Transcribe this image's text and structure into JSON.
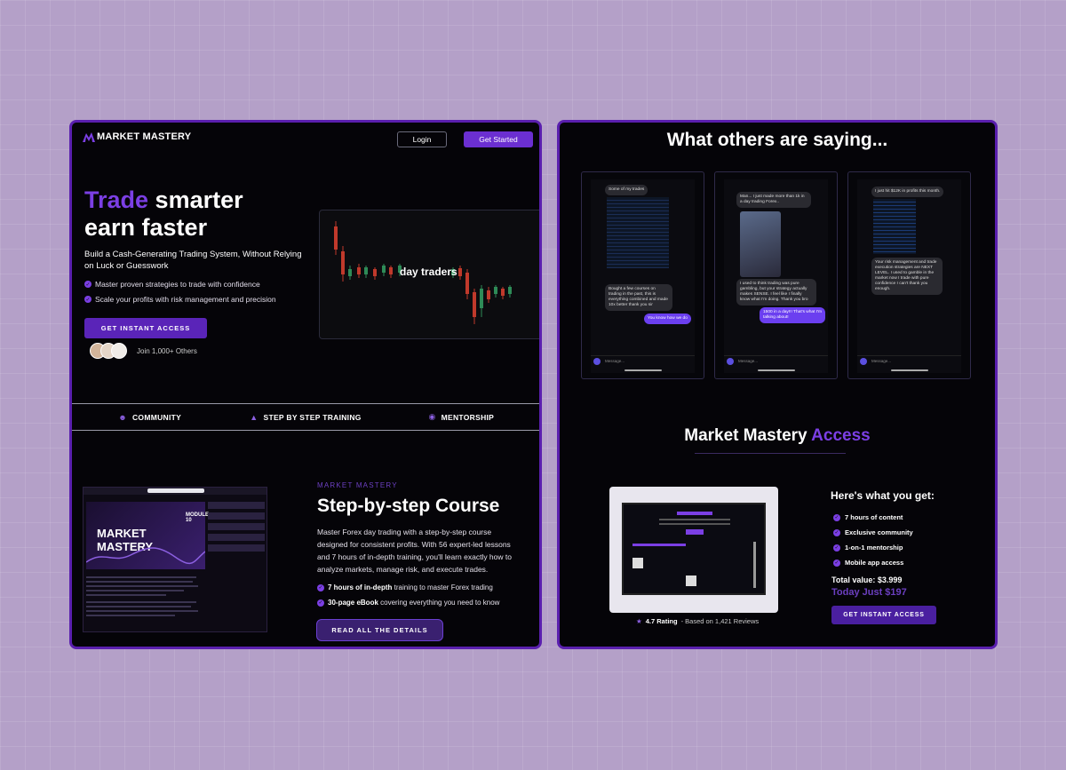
{
  "header": {
    "logo": "MARKET MASTERY",
    "login_label": "Login",
    "get_started_label": "Get Started"
  },
  "hero": {
    "title_accent": "Trade",
    "title_rest": " smarter",
    "title_line2": "earn faster",
    "subtitle": "Build a Cash-Generating Trading System, Without Relying on Luck or Guesswork",
    "bullets": [
      "Master proven strategies to trade with confidence",
      "Scale your profits with risk management and precision"
    ],
    "cta_label": "GET INSTANT ACCESS",
    "social_proof": "Join 1,000+ Others",
    "video_caption": "day traders"
  },
  "features": [
    {
      "icon": "users-icon",
      "label": "COMMUNITY"
    },
    {
      "icon": "graduation-cap-icon",
      "label": "STEP BY STEP TRAINING"
    },
    {
      "icon": "medal-icon",
      "label": "MENTORSHIP"
    }
  ],
  "course": {
    "kicker": "MARKET MASTERY",
    "title": "Step-by-step Course",
    "body": "Master Forex day trading with a step-by-step course designed for consistent profits. With 56 expert-led lessons and 7 hours of in-depth training, you'll learn exactly how to analyze markets, manage risk, and execute trades.",
    "bullet1_bold": "7 hours of in-depth",
    "bullet1_rest": " training to master Forex trading",
    "bullet2_bold": "30-page eBook",
    "bullet2_rest": " covering everything you need to know",
    "cta_label": "READ ALL THE DETAILS",
    "module_tag": "MODULE 10",
    "screenshot_logo": "MARKET MASTERY"
  },
  "testimonials": {
    "title": "What others are saying...",
    "phones": [
      {
        "top_msg": "Some of my trades",
        "msg2": "Bought a few courses on trading in the past, this is everything combined and made 10x better thank you sir",
        "reply": "You know how we do",
        "input": "Message..."
      },
      {
        "top_msg": "Man... I just made more than 1k in a day trading Forex..",
        "msg2": "I used to think trading was pure gambling, but your strategy actually makes SENSE. I feel like I finally know what I'm doing. Thank you bro",
        "reply": "1500 in a day!!! That's what I'm talking about!",
        "input": "Message..."
      },
      {
        "top_msg": "I just hit $12K in profits this month.",
        "msg2": "Your risk management and trade execution strategies are NEXT LEVEL. I used to gamble in the market now I trade with pure confidence I can't thank you enough.",
        "reply": "",
        "input": "Message..."
      }
    ]
  },
  "access": {
    "title": "Market Mastery",
    "title_accent": " Access",
    "rating_value": "4.7 Rating",
    "rating_text": "- Based on 1,421 Reviews",
    "get_title": "Here's what you get:",
    "items": [
      "7 hours of content",
      "Exclusive community",
      "1-on-1 mentorship",
      "Mobile app access"
    ],
    "total": "Total value: $3.999",
    "today": "Today Just $197",
    "cta_label": "GET INSTANT ACCESS"
  },
  "colors": {
    "accent": "#7b3fe4",
    "panel_border": "#5a1fae",
    "background": "#b4a0c8"
  }
}
